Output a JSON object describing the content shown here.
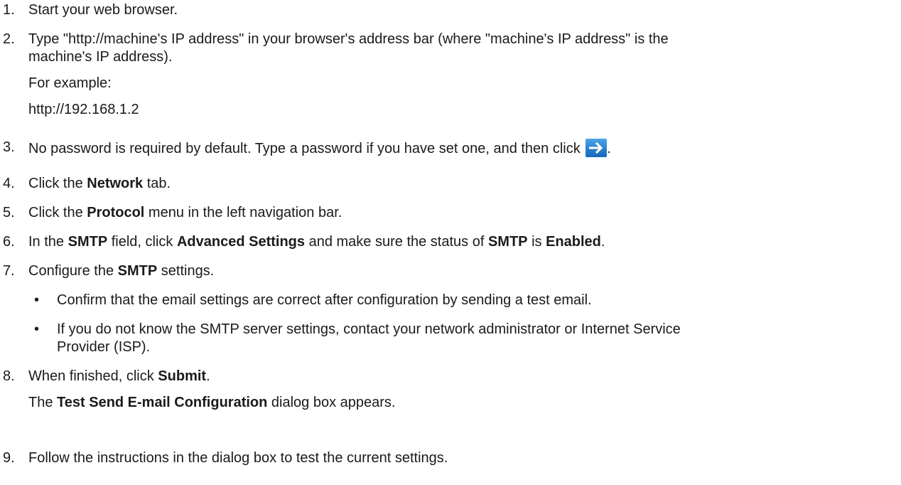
{
  "steps": [
    {
      "num": "1.",
      "text": "Start your web browser."
    },
    {
      "num": "2.",
      "text": "Type \"http://machine's IP address\" in your browser's address bar (where \"machine's IP address\" is the",
      "text2": "machine's IP address).",
      "sub1": "For example:",
      "sub2": "http://192.168.1.2"
    },
    {
      "num": "3.",
      "text": "No password is required by default. Type a password if you have set one, and then click",
      "end": "."
    },
    {
      "num": "4.",
      "a": "Click the ",
      "b": "Network",
      "c": " tab."
    },
    {
      "num": "5.",
      "a": "Click the ",
      "b": "Protocol",
      "c": " menu in the left navigation bar."
    },
    {
      "num": "6.",
      "a": "In the ",
      "b": "SMTP",
      "c": " field, click ",
      "d": "Advanced Settings",
      "e": " and make sure the status of ",
      "f": "SMTP",
      "g": " is ",
      "h": "Enabled",
      "i": "."
    },
    {
      "num": "7.",
      "a": "Configure the ",
      "b": "SMTP",
      "c": " settings.",
      "bullets": [
        {
          "dot": "•",
          "text": "Confirm that the email settings are correct after configuration by sending a test email."
        },
        {
          "dot": "•",
          "text": "If you do not know the SMTP server settings, contact your network administrator or Internet Service",
          "text2": "Provider (ISP)."
        }
      ]
    },
    {
      "num": "8.",
      "a": "When finished, click ",
      "b": "Submit",
      "c": ".",
      "sub_a": "The ",
      "sub_b": "Test Send E-mail Configuration",
      "sub_c": " dialog box appears."
    },
    {
      "num": "9.",
      "text": "Follow the instructions in the dialog box to test the current settings."
    }
  ],
  "icons": {
    "submit_arrow": "arrow-right-icon",
    "arrow_color": "#1566b8"
  }
}
